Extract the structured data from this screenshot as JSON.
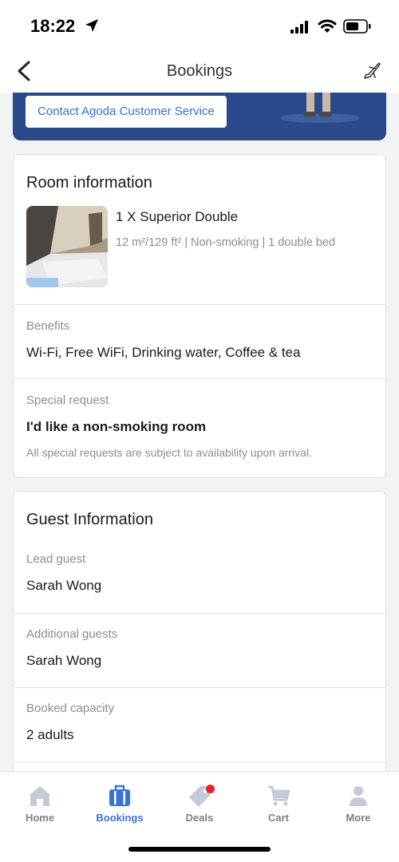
{
  "status_bar": {
    "time": "18:22"
  },
  "nav": {
    "title": "Bookings"
  },
  "banner": {
    "button_label": "Contact Agoda Customer Service"
  },
  "room_info": {
    "title": "Room information",
    "room_name": "1 X Superior Double",
    "room_details": "12 m²/129 ft² | Non-smoking | 1 double bed",
    "benefits_label": "Benefits",
    "benefits_value": "Wi-Fi, Free WiFi, Drinking water, Coffee & tea",
    "special_request_label": "Special request",
    "special_request_value": "I'd like a non-smoking room",
    "special_request_note": "All special requests are subject to availability upon arrival."
  },
  "guest_info": {
    "title": "Guest Information",
    "lead_guest_label": "Lead guest",
    "lead_guest_value": "Sarah Wong",
    "additional_guests_label": "Additional guests",
    "additional_guests_value": "Sarah Wong",
    "booked_capacity_label": "Booked capacity",
    "booked_capacity_value": "2 adults"
  },
  "tabs": [
    {
      "label": "Home",
      "icon": "home-icon",
      "active": false
    },
    {
      "label": "Bookings",
      "icon": "suitcase-icon",
      "active": true
    },
    {
      "label": "Deals",
      "icon": "tag-icon",
      "active": false
    },
    {
      "label": "Cart",
      "icon": "cart-icon",
      "active": false
    },
    {
      "label": "More",
      "icon": "person-icon",
      "active": false
    }
  ],
  "colors": {
    "accent": "#3a73d6",
    "banner": "#2b4a8b",
    "badge": "#e8202a",
    "inactive_icon": "#c5cbd6"
  }
}
